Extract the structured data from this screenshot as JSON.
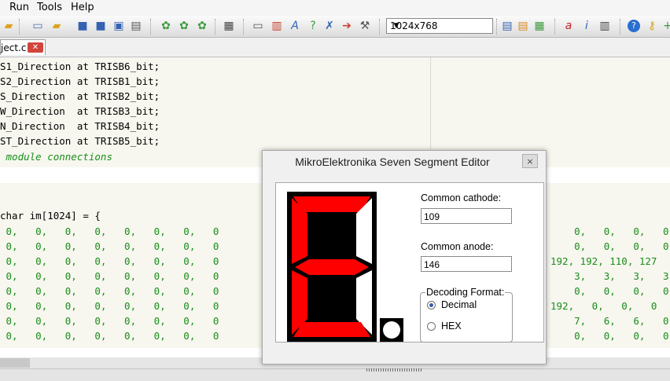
{
  "menu": {
    "run": "Run",
    "tools": "Tools",
    "help": "Help"
  },
  "toolbar": {
    "resolution": "1024x768"
  },
  "tab": {
    "label": "ject.c",
    "close": "✕"
  },
  "code": {
    "lines": [
      "S1_Direction at TRISB6_bit;",
      "S2_Direction at TRISB1_bit;",
      "S_Direction  at TRISB2_bit;",
      "W_Direction  at TRISB3_bit;",
      "N_Direction  at TRISB4_bit;",
      "ST_Direction at TRISB5_bit;"
    ],
    "comment": " module connections",
    "decl": "char im[1024] = {",
    "rows_left": [
      " 0,   0,   0,   0,   0,   0,   0,   0",
      " 0,   0,   0,   0,   0,   0,   0,   0",
      " 0,   0,   0,   0,   0,   0,   0,   0",
      " 0,   0,   0,   0,   0,   0,   0,   0",
      " 0,   0,   0,   0,   0,   0,   0,   0",
      " 0,   0,   0,   0,   0,   0,   0,   0",
      " 0,   0,   0,   0,   0,   0,   0,   0",
      " 0,   0,   0,   0,   0,   0,   0,   0"
    ],
    "rows_right": [
      "    0,   0,   0,   0",
      "    0,   0,   0,   0",
      "192, 192, 110, 127",
      "    3,   3,   3,   3",
      "    0,   0,   0,   0",
      "192,   0,   0,   0",
      "    7,   6,   6,   0",
      "    0,   0,   0,   0"
    ]
  },
  "dialog": {
    "title": "MikroElektronika Seven Segment Editor",
    "close": "×",
    "common_cathode_label": "Common cathode:",
    "common_cathode_value": "109",
    "common_anode_label": "Common anode:",
    "common_anode_value": "146",
    "decoding_label": "Decoding Format:",
    "decimal_label": "Decimal",
    "hex_label": "HEX",
    "segments": {
      "a": true,
      "b": false,
      "c": false,
      "d": true,
      "e": true,
      "f": true,
      "g": true,
      "dp": false
    }
  },
  "colors": {
    "segment_on": "#ff0000",
    "segment_off": "#ffffff",
    "segment_bg": "#000000",
    "code_number": "#1a8c1a"
  }
}
